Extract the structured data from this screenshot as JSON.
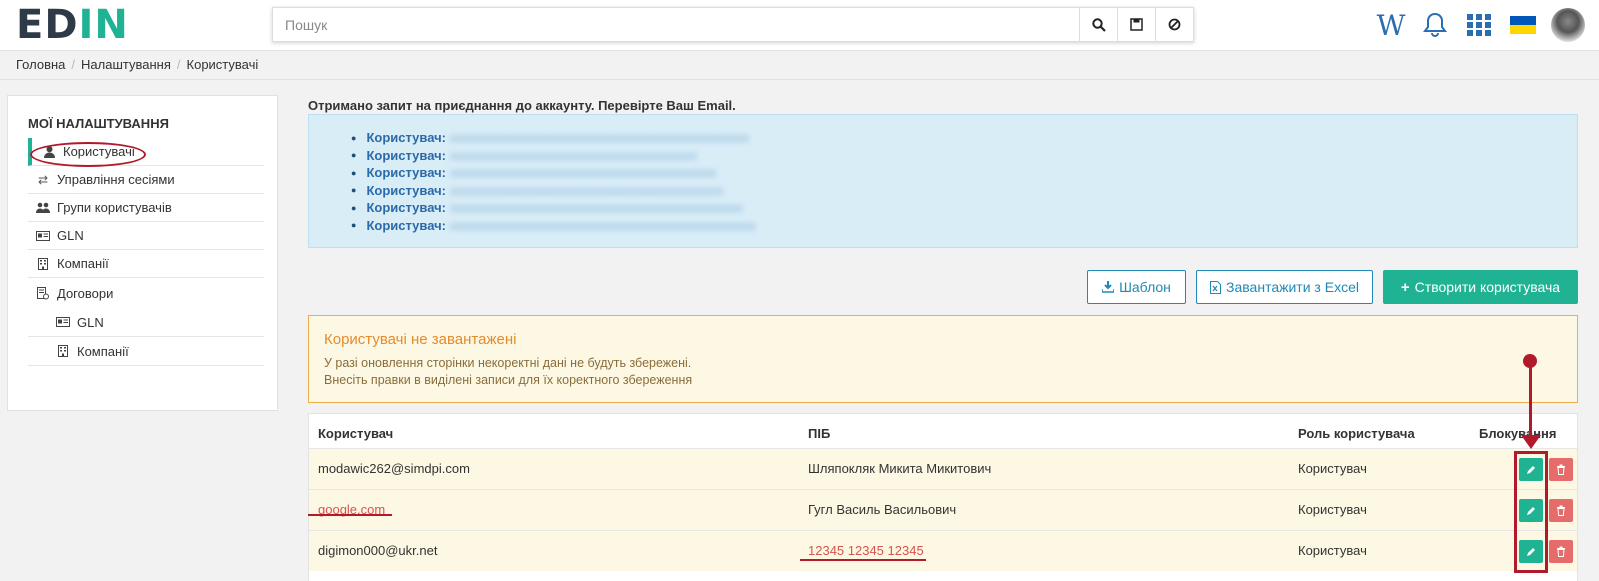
{
  "header": {
    "logo": {
      "part1": "ED",
      "part2": "IN"
    },
    "search_placeholder": "Пошук"
  },
  "breadcrumb": [
    "Головна",
    "Налаштування",
    "Користувачі"
  ],
  "sidebar": {
    "title": "МОЇ НАЛАШТУВАННЯ",
    "items": [
      {
        "label": "Користувачі",
        "icon": "user-icon"
      },
      {
        "label": "Управління сесіями",
        "icon": "exchange-icon"
      },
      {
        "label": "Групи користувачів",
        "icon": "users-icon"
      },
      {
        "label": "GLN",
        "icon": "id-card-icon"
      },
      {
        "label": "Компанії",
        "icon": "building-icon"
      },
      {
        "label": "Договори",
        "icon": "contract-icon"
      }
    ],
    "sub_items": [
      {
        "label": "GLN",
        "icon": "id-card-icon"
      },
      {
        "label": "Компанії",
        "icon": "building-icon"
      }
    ]
  },
  "notice": "Отримано запит на приєднання до аккаунту. Перевірте Ваш Email.",
  "info_list": {
    "label": "Користувач:",
    "count": 6
  },
  "buttons": {
    "template": "Шаблон",
    "upload": "Завантажити з Excel",
    "create": "Створити користувача"
  },
  "warning": {
    "title": "Користувачі не завантажені",
    "line1": "У разі оновлення сторінки некоректні дані не будуть збережені.",
    "line2": "Внесіть правки в виділені записи для їх коректного збереження"
  },
  "table": {
    "headers": {
      "user": "Користувач",
      "name": "ПІБ",
      "role": "Роль користувача",
      "block": "Блокування"
    },
    "rows": [
      {
        "user": "modawic262@simdpi.com",
        "name": "Шляпокляк Микита Микитович",
        "role": "Користувач"
      },
      {
        "user": "google.com",
        "name": "Гугл Василь Васильович",
        "role": "Користувач"
      },
      {
        "user": "digimon000@ukr.net",
        "name": "12345 12345 12345",
        "role": "Користувач"
      }
    ]
  },
  "colors": {
    "accent": "#1fb394",
    "link": "#1f8ab8",
    "error": "#d9534f",
    "annotation": "#b11a2a"
  }
}
